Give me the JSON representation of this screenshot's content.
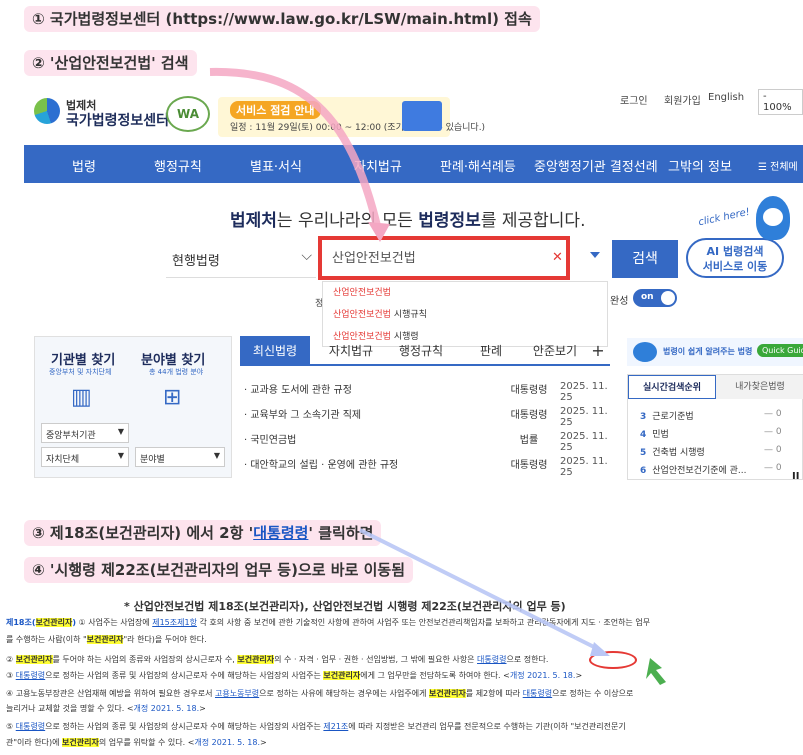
{
  "steps": {
    "s1": "① 국가법령정보센터 (https://www.law.go.kr/LSW/main.html) 접속",
    "s2": "② '산업안전보건법' 검색",
    "s3_pre": "③ 제18조(보건관리자) 에서 2항 '",
    "s3_link": "대통령령",
    "s3_post": "' 클릭하면",
    "s4": "④ '시행령 제22조(보건관리자의 업무 등)으로 바로 이동됨"
  },
  "header": {
    "logo_line1": "법제처",
    "logo_line2": "국가법령정보센터",
    "wa_badge": "WA",
    "notice_title": "서비스 점검 안내",
    "notice_text": "일정 : 11월 29일(토) 00:00 ~ 12:00 (조기 종료될 수 있습니다.)",
    "login": "로그인",
    "signup": "회원가입",
    "english": "English",
    "zoom": "- 100%"
  },
  "nav": [
    "법령",
    "행정규칙",
    "별표·서식",
    "자치법규",
    "판례·해석례등",
    "중앙행정기관 결정선례",
    "그밖의 정보",
    "전체메"
  ],
  "hero": {
    "pre": "는 우리나라의 모든 ",
    "brand": "법제처",
    "emph": "법령정보",
    "post": "를 제공합니다."
  },
  "promo": {
    "click_here": "click here!",
    "line1": "AI 법령검색",
    "line2": "서비스로 이동"
  },
  "search": {
    "scope": "현행법령",
    "value": "산업안전보건법",
    "button": "검색",
    "complete_label": "완성",
    "toggle": "on",
    "left_label": "정",
    "suggestions": [
      {
        "hl": "산업안전보건법",
        "rest": ""
      },
      {
        "hl": "산업안전보건법",
        "rest": " 시행규칙"
      },
      {
        "hl": "산업안전보건법",
        "rest": " 시행령"
      }
    ]
  },
  "left_panel": {
    "agency_title": "기관별 찾기",
    "agency_sub": "중앙부처 및 자치단체",
    "field_title": "분야별 찾기",
    "field_sub": "총 44개 법령 분야",
    "select1": "중앙부처기관",
    "select2": "자치단체",
    "select3": "분야별"
  },
  "tabs": [
    "최신법령",
    "자치법규",
    "행정규칙",
    "판례",
    "안준보기",
    "+"
  ],
  "latest": [
    {
      "title": "· 교과용 도서에 관한 규정",
      "type": "대통령령",
      "date": "2025. 11. 25"
    },
    {
      "title": "· 교육부와 그 소속기관 직제",
      "type": "대통령령",
      "date": "2025. 11. 25"
    },
    {
      "title": "· 국민연금법",
      "type": "법률",
      "date": "2025. 11. 25"
    },
    {
      "title": "· 대안학교의 설립 · 운영에 관한 규정",
      "type": "대통령령",
      "date": "2025. 11. 25"
    }
  ],
  "right_panel": {
    "banner": "법령이 쉽게 알려주는 법령",
    "quick": "Quick Guide",
    "tab1": "실시간검색순위",
    "tab2": "내가찾은법령",
    "ranks": [
      {
        "n": "3",
        "name": "근로기준법",
        "chg": "— 0"
      },
      {
        "n": "4",
        "name": "민법",
        "chg": "— 0"
      },
      {
        "n": "5",
        "name": "건축법 시행령",
        "chg": "— 0"
      },
      {
        "n": "6",
        "name": "산업안전보건기준에 관...",
        "chg": "— 0"
      }
    ],
    "pause": "II"
  },
  "law": {
    "heading": "* 산업안전보건법 제18조(보건관리자), 산업안전보건법 시행령 제22조(보건관리자의 업무 등)",
    "art_title_pre": "제18조(",
    "art_title_hl": "보건관리자",
    "art_title_post": ")",
    "l1a": " ① 사업주는 사업장에 ",
    "l1_link": "제15조제1항",
    "l1b": " 각 호의 사항 중 보건에 관한 기술적인 사항에 관하여 사업주 또는 안전보건관리책임자를 보좌하고 관리감독자에게 지도 · 조언하는 업무",
    "l2a": "를 수행하는 사람(이하 \"",
    "l2_hl": "보건관리자",
    "l2b": "\"라 한다)을 두어야 한다.",
    "l3a": "② ",
    "l3_hl1": "보건관리자",
    "l3b": "를 두어야 하는 사업의 종류와 사업장의 상시근로자 수, ",
    "l3_hl2": "보건관리자",
    "l3c": "의 수 · 자격 · 업무 · 권한 · 선임방법, 그 밖에 필요한 사항은 ",
    "l3_link": "대통령령",
    "l3d": "으로 정한다.",
    "l4a": "③ ",
    "l4_link1": "대통령령",
    "l4b": "으로 정하는 사업의 종류 및 사업장의 상시근로자 수에 해당하는 사업장의 사업주는 ",
    "l4_hl": "보건관리자",
    "l4c": "에게 그 업무만을 전담하도록 하여야 한다. <",
    "l4_rev": "개정 2021. 5. 18.",
    "l4d": ">",
    "l5a": "④ 고용노동부장관은 산업재해 예방을 위하여 필요한 경우로서 ",
    "l5_link1": "고용노동부령",
    "l5b": "으로 정하는 사유에 해당하는 경우에는 사업주에게 ",
    "l5_hl": "보건관리자",
    "l5c": "를 제2항에 따라 ",
    "l5_link2": "대통령령",
    "l5d": "으로 정하는 수 이상으로",
    "l6a": "늘리거나 교체할 것을 명할 수 있다. <",
    "l6_rev": "개정 2021. 5. 18.",
    "l6b": ">",
    "l7a": "⑤ ",
    "l7_link1": "대통령령",
    "l7b": "으로 정하는 사업의 종류 및 사업장의 상시근로자 수에 해당하는 사업장의 사업주는 ",
    "l7_link2": "제21조",
    "l7c": "에 따라 지정받은 보건관리 업무를 전문적으로 수행하는 기관(이하 \"보건관리전문기",
    "l8a": "관\"이라 한다)에 ",
    "l8_hl": "보건관리자",
    "l8b": "의 업무를 위탁할 수 있다. <",
    "l8_rev": "개정 2021. 5. 18.",
    "l8c": ">"
  },
  "colors": {
    "nav_blue": "#3569c4",
    "highlight_red": "#e53935",
    "step_pink": "#fde4ee",
    "mark_yellow": "#ffff33"
  }
}
